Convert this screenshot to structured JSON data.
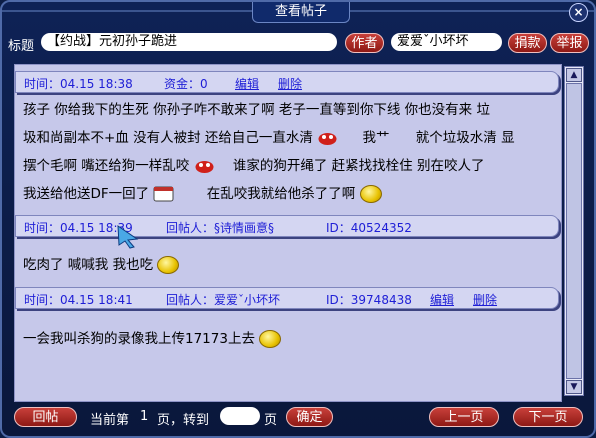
{
  "window": {
    "title": "查看帖子",
    "close_label": "×"
  },
  "header": {
    "title_label": "标题",
    "title_value": "【约战】元初孙子跪进",
    "author_button": "作者",
    "author_value": "爱爱ˇ小坏坏",
    "donate_button": "捐款",
    "report_button": "举报"
  },
  "posts": [
    {
      "meta": {
        "time_label": "时间：04.15 18:38",
        "funds_label": "资金：0",
        "edit_link": "编辑",
        "delete_link": "删除"
      },
      "lines": [
        "孩子 你给我下的生死    你孙子咋不敢来了啊    老子一直等到你下线    你也没有来    垃",
        "圾和尚副本不+血    没有人被封    还给自己一直水清",
        "摆个毛啊      嘴还给狗一样乱咬",
        "我送给他送DF一回了",
        ""
      ],
      "frag": {
        "a": "我艹",
        "b": "就个垃圾水清    显",
        "c": "谁家的狗开绳了    赶紧找找栓住    别在咬人了",
        "d": "在乱咬我就给他杀了了啊"
      }
    },
    {
      "meta": {
        "time_label": "时间：04.15 18:39",
        "replier_label": "回帖人：§诗情画意§",
        "id_label": "ID：40524352"
      },
      "lines": [
        "吃肉了  喊喊我  我也吃"
      ]
    },
    {
      "meta": {
        "time_label": "时间：04.15 18:41",
        "replier_label": "回帖人：爱爱ˇ小坏坏",
        "id_label": "ID：39748438",
        "edit_link": "编辑",
        "delete_link": "删除"
      },
      "lines": [
        "一会我叫杀狗的录像我上传17173上去"
      ]
    }
  ],
  "footer": {
    "reply_button": "回帖",
    "page_prefix": "当前第",
    "page_number": "1",
    "page_middle": "页，转到",
    "page_suffix": "页",
    "confirm_button": "确定",
    "prev_button": "上一页",
    "next_button": "下一页"
  },
  "scrollbar": {
    "up": "▲",
    "down": "▼"
  }
}
